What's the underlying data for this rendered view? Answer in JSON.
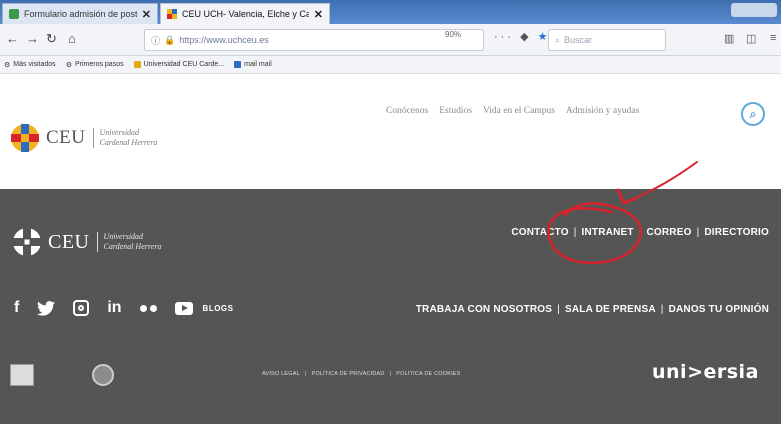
{
  "browser": {
    "tabs": [
      {
        "title": "Formulario admisión de post...",
        "active": false
      },
      {
        "title": "CEU UCH- Valencia, Elche y Ca...",
        "active": true
      }
    ],
    "url": "https://www.uchceu.es",
    "zoom": "90%",
    "search_placeholder": "Buscar",
    "bookmarks": [
      "Más visitados",
      "Primeros pasos",
      "Universidad CEU Carde...",
      "mail mail"
    ]
  },
  "header": {
    "logo_ceu": "CEU",
    "logo_uni_line1": "Universidad",
    "logo_uni_line2": "Cardenal Herrera",
    "nav": [
      "Conócenos",
      "Estudios",
      "Vida en el Campus",
      "Admisión y ayudas"
    ]
  },
  "footer": {
    "logo_ceu": "CEU",
    "logo_uni_line1": "Universidad",
    "logo_uni_line2": "Cardenal Herrera",
    "links_row1": [
      "CONTACTO",
      "INTRANET",
      "CORREO",
      "DIRECTORIO"
    ],
    "blogs_label": "BLOGS",
    "links_row2": [
      "TRABAJA CON NOSOTROS",
      "SALA DE PRENSA",
      "DANOS TU OPINIÓN"
    ],
    "legal": [
      "AVISO LEGAL",
      "POLÍTICA DE PRIVACIDAD",
      "POLÍTICA DE COOKIES"
    ],
    "universia": "uni>ersia"
  },
  "colors": {
    "footer_bg": "#555555",
    "annotation": "#d8232a",
    "search_accent": "#5fa8d8"
  }
}
